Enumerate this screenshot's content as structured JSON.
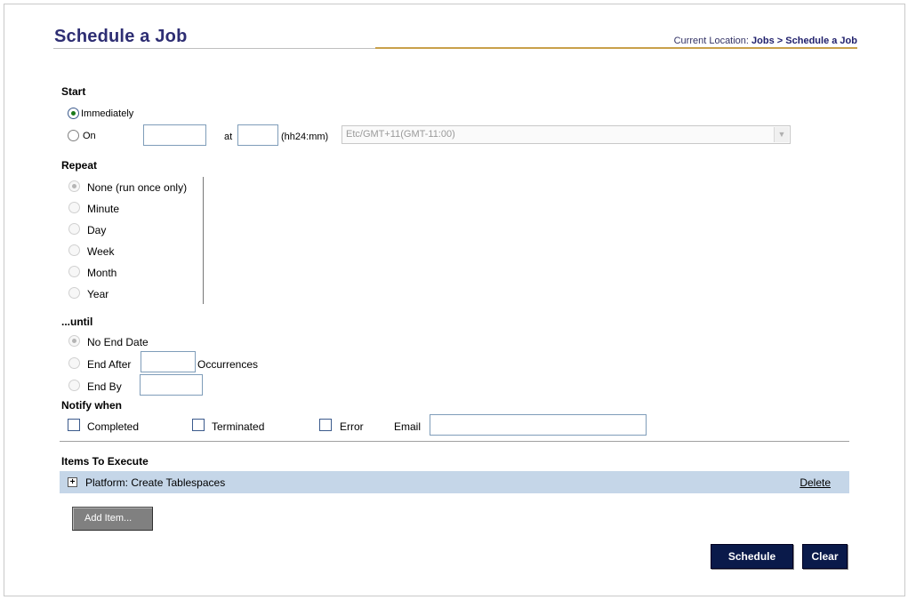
{
  "page": {
    "title": "Schedule a Job",
    "breadcrumb": {
      "label": "Current Location:",
      "parent": "Jobs",
      "separator": ">",
      "current": "Schedule a Job"
    }
  },
  "start": {
    "heading": "Start",
    "immediately_label": "Immediately",
    "on_label": "On",
    "date_value": "",
    "at_label": "at",
    "time_value": "",
    "time_format_label": "(hh24:mm)",
    "timezone_selected": "Etc/GMT+11(GMT-11:00)",
    "selected": "Immediately"
  },
  "repeat": {
    "heading": "Repeat",
    "options": [
      "None (run once only)",
      "Minute",
      "Day",
      "Week",
      "Month",
      "Year"
    ],
    "selected": "None (run once only)"
  },
  "until": {
    "heading": "...until",
    "no_end_label": "No End Date",
    "end_after_label": "End After",
    "occurrences_value": "",
    "occurrences_label": "Occurrences",
    "end_by_label": "End By",
    "end_by_value": "",
    "selected": "No End Date"
  },
  "notify": {
    "heading": "Notify when",
    "completed_label": "Completed",
    "terminated_label": "Terminated",
    "error_label": "Error",
    "email_label": "Email",
    "email_value": ""
  },
  "items": {
    "heading": "Items To Execute",
    "rows": [
      {
        "label": "Platform: Create Tablespaces",
        "delete_label": "Delete"
      }
    ],
    "add_button": "Add Item..."
  },
  "actions": {
    "schedule": "Schedule",
    "clear": "Clear"
  },
  "colors": {
    "title": "#2e2e73",
    "accent_rule": "#c8a04a",
    "item_row_bg": "#c5d6e8",
    "primary_button": "#0a1a4a",
    "secondary_button": "#808080"
  }
}
